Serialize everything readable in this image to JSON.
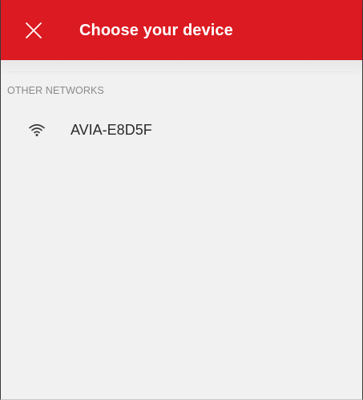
{
  "app_bar": {
    "title": "Choose your device",
    "close_icon": "close-icon",
    "background_color": "#db1a21"
  },
  "networks": {
    "section_header": "OTHER NETWORKS",
    "items": [
      {
        "name": "AVIA-E8D5F",
        "icon": "wifi-icon"
      }
    ]
  }
}
